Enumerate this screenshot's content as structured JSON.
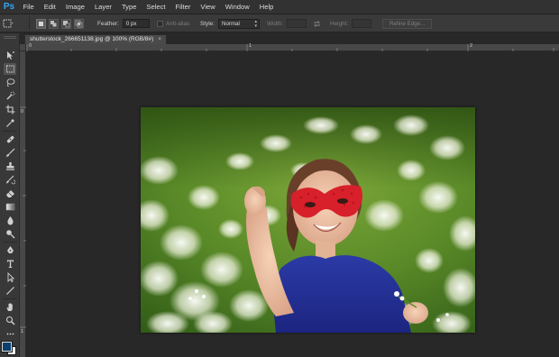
{
  "app": {
    "logo": "Ps"
  },
  "menu": [
    "File",
    "Edit",
    "Image",
    "Layer",
    "Type",
    "Select",
    "Filter",
    "View",
    "Window",
    "Help"
  ],
  "options": {
    "feather_label": "Feather:",
    "feather_value": "0 px",
    "anti_alias_label": "Anti-alias",
    "style_label": "Style:",
    "style_value": "Normal",
    "width_label": "Width:",
    "height_label": "Height:",
    "refine_edge_label": "Refine Edge..."
  },
  "document": {
    "tab_title": "shutterstock_266651138.jpg @ 100% (RGB/8#)",
    "close_glyph": "×"
  },
  "rulers": {
    "top_labels": [
      "0",
      "1",
      "2"
    ],
    "left_labels": [
      "0",
      "1"
    ]
  },
  "tools": [
    "move-tool",
    "marquee-tool",
    "lasso-tool",
    "quick-selection-tool",
    "crop-tool",
    "eyedropper-tool",
    "spot-healing-tool",
    "brush-tool",
    "clone-stamp-tool",
    "history-brush-tool",
    "eraser-tool",
    "gradient-tool",
    "blur-tool",
    "dodge-tool",
    "pen-tool",
    "type-tool",
    "path-selection-tool",
    "shape-tool",
    "hand-tool",
    "zoom-tool"
  ],
  "colors": {
    "ps_blue": "#36a5f0",
    "foreground_swatch": "#0a3f6e",
    "background_swatch": "#ffffff"
  }
}
